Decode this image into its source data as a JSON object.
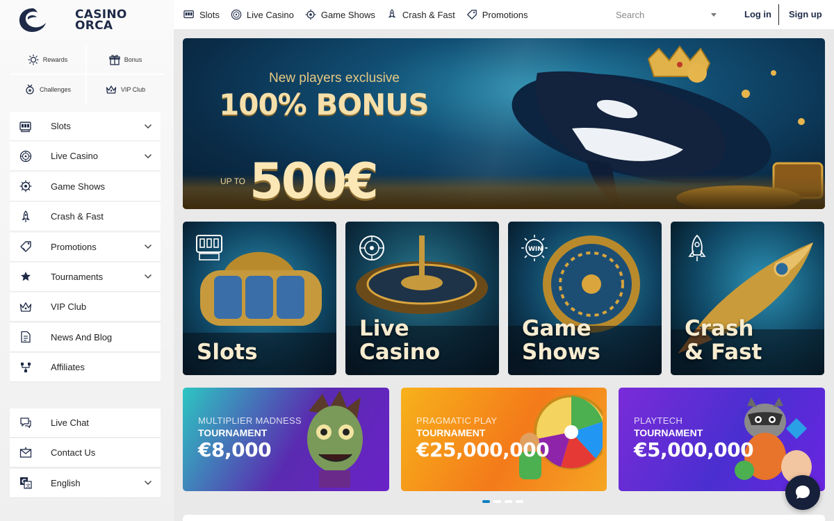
{
  "brand": {
    "line1": "CASINO",
    "line2": "ORCA"
  },
  "quick_links": [
    {
      "label": "Rewards",
      "icon": "sun-badge-icon"
    },
    {
      "label": "Bonus",
      "icon": "gift-icon"
    },
    {
      "label": "Challenges",
      "icon": "medal-icon"
    },
    {
      "label": "VIP Club",
      "icon": "crown-icon"
    }
  ],
  "sidebar": {
    "items": [
      {
        "label": "Slots",
        "icon": "slot-machine-icon",
        "expandable": true
      },
      {
        "label": "Live Casino",
        "icon": "roulette-icon",
        "expandable": true
      },
      {
        "label": "Game Shows",
        "icon": "wheel-icon",
        "expandable": false
      },
      {
        "label": "Crash & Fast",
        "icon": "rocket-icon",
        "expandable": false
      },
      {
        "label": "Promotions",
        "icon": "ticket-icon",
        "expandable": true
      },
      {
        "label": "Tournaments",
        "icon": "trophy-icon",
        "expandable": true
      },
      {
        "label": "VIP Club",
        "icon": "crown-icon",
        "expandable": false
      },
      {
        "label": "News And Blog",
        "icon": "document-icon",
        "expandable": false
      },
      {
        "label": "Affiliates",
        "icon": "network-icon",
        "expandable": false
      }
    ],
    "bottom_items": [
      {
        "label": "Live Chat",
        "icon": "chat-icon",
        "expandable": false
      },
      {
        "label": "Contact Us",
        "icon": "mail-icon",
        "expandable": false
      },
      {
        "label": "English",
        "icon": "language-icon",
        "expandable": true
      }
    ]
  },
  "topnav": [
    {
      "label": "Slots",
      "icon": "slot-machine-icon"
    },
    {
      "label": "Live Casino",
      "icon": "roulette-icon"
    },
    {
      "label": "Game Shows",
      "icon": "wheel-icon"
    },
    {
      "label": "Crash & Fast",
      "icon": "rocket-icon"
    },
    {
      "label": "Promotions",
      "icon": "ticket-icon"
    }
  ],
  "search": {
    "placeholder": "Search"
  },
  "auth": {
    "login": "Log in",
    "signup": "Sign up"
  },
  "hero": {
    "subtitle": "New players exclusive",
    "title": "100% BONUS",
    "upto": "UP TO",
    "amount": "500€"
  },
  "categories": [
    {
      "label": "Slots",
      "icon": "slot-machine-icon"
    },
    {
      "label": "Live\nCasino",
      "icon": "roulette-icon"
    },
    {
      "label": "Game\nShows",
      "icon": "win-wheel-icon"
    },
    {
      "label": "Crash\n& Fast",
      "icon": "rocket-icon"
    }
  ],
  "promos": [
    {
      "provider": "MULTIPLIER MADNESS",
      "type": "TOURNAMENT",
      "amount": "€8,000",
      "colors": [
        "#2dc6c2",
        "#5a2bb0",
        "#6a22c8"
      ]
    },
    {
      "provider": "PRAGMATIC PLAY",
      "type": "TOURNAMENT",
      "amount": "€25,000,000",
      "colors": [
        "#f7b21b",
        "#f47a1a",
        "#f5a623"
      ]
    },
    {
      "provider": "PLAYTECH",
      "type": "TOURNAMENT",
      "amount": "€5,000,000",
      "colors": [
        "#7a2bd8",
        "#4a2fd0",
        "#6a25e0"
      ]
    }
  ],
  "carousel": {
    "pages": 4,
    "active": 0
  }
}
